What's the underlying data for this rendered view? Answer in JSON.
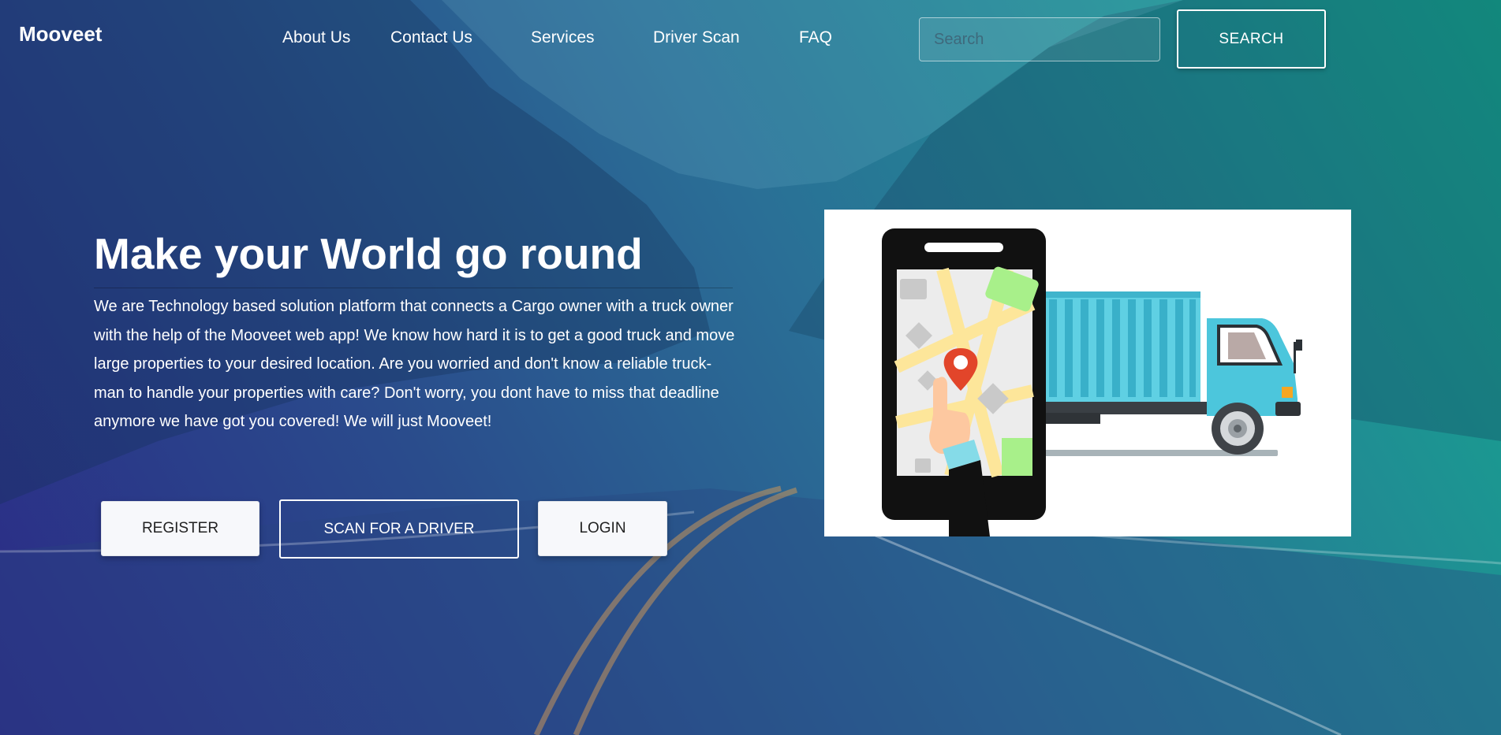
{
  "brand": {
    "name": "Mooveet"
  },
  "nav": {
    "links": [
      {
        "label": "About Us"
      },
      {
        "label": "Contact Us"
      },
      {
        "label": "Services"
      },
      {
        "label": "Driver Scan"
      },
      {
        "label": "FAQ"
      }
    ]
  },
  "search": {
    "placeholder": "Search",
    "value": "",
    "button_label": "SEARCH"
  },
  "hero": {
    "title": "Make your World go round",
    "description": "We are Technology based solution platform that connects a Cargo owner with a truck owner with the help of the Mooveet web app! We know how hard it is to get a good truck and move large properties to your desired location. Are you worried and don't know a reliable truck-man to handle your properties with care? Don't worry, you dont have to miss that deadline anymore we have got you covered! We will just Mooveet!",
    "buttons": {
      "register": "REGISTER",
      "scan": "SCAN FOR A DRIVER",
      "login": "LOGIN"
    }
  },
  "icons": {
    "illustration": "phone-map-truck-illustration",
    "pin": "location-pin-icon"
  },
  "colors": {
    "gradient_start": "#2b2a86",
    "gradient_end": "#12a98c",
    "truck": "#4cc6dc",
    "phone": "#111111",
    "pin": "#e2452a"
  }
}
